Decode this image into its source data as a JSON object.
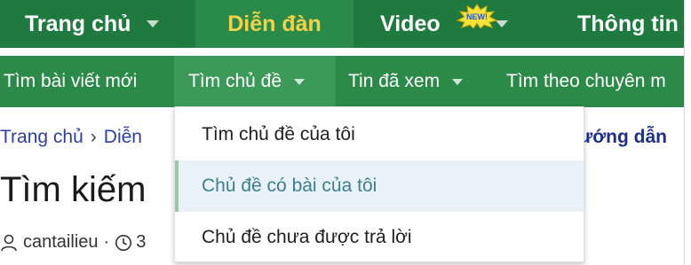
{
  "topnav": {
    "tabs": [
      {
        "label": "Trang chủ",
        "has_caret": true
      },
      {
        "label": "Diễn đàn",
        "active": true
      },
      {
        "label": "Video",
        "has_caret": true,
        "badge": "NEW!"
      },
      {
        "label": "Thông tin"
      }
    ]
  },
  "subnav": {
    "items": [
      {
        "label": "Tìm bài viết mới"
      },
      {
        "label": "Tìm chủ đề",
        "active": true
      },
      {
        "label": "Tin đã xem"
      },
      {
        "label": "Tìm theo chuyên m"
      }
    ]
  },
  "breadcrumb": {
    "items": [
      "Trang chủ",
      "Diễn"
    ],
    "separator": "›"
  },
  "guide_link": "ướng dẫn",
  "page_title": "Tìm kiếm",
  "meta": {
    "author": "cantailieu",
    "separator": "·",
    "time_partial": "3"
  },
  "dropdown": {
    "options": [
      {
        "label": "Tìm chủ đề của tôi"
      },
      {
        "label": "Chủ đề có bài của tôi",
        "hovered": true
      },
      {
        "label": "Chủ đề chưa được trả lời"
      }
    ]
  },
  "colors": {
    "nav_bg": "#1f7a3f",
    "subnav_bg": "#2c8a49",
    "active_tab_text": "#f2d24b",
    "link": "#2b3fa6",
    "dropdown_hover_bg": "#e9f2f9"
  }
}
